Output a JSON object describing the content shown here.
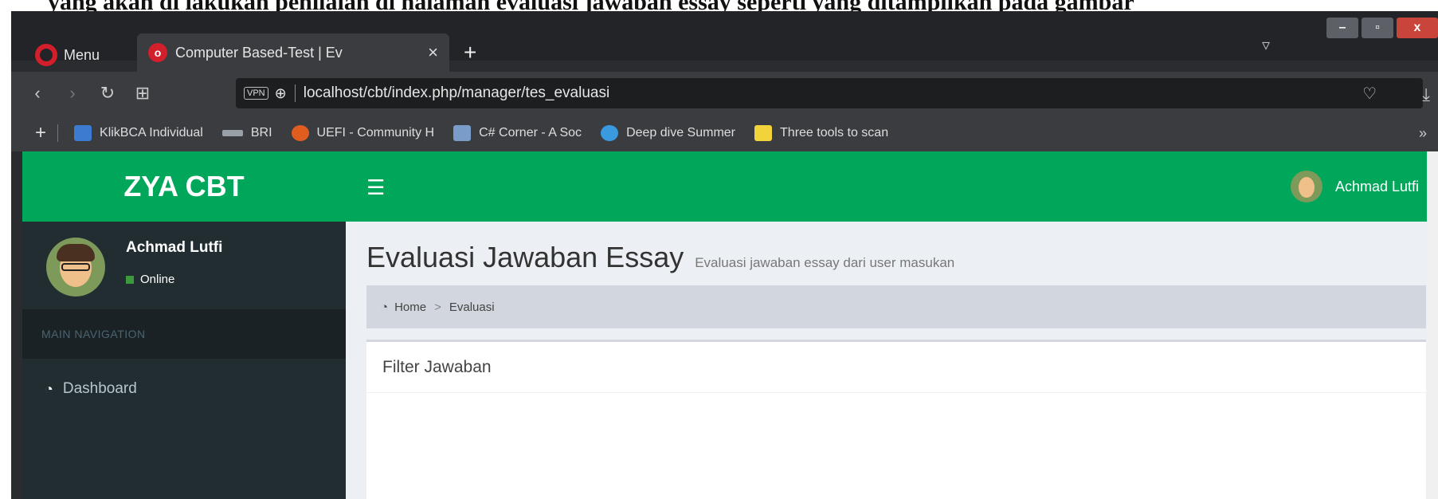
{
  "browser": {
    "menu_label": "Menu",
    "tab_title": "Computer Based-Test | Ev",
    "tab_close": "×",
    "new_tab": "+",
    "url": "localhost/cbt/index.php/manager/tes_evaluasi",
    "vpn_label": "VPN",
    "bookmarks": [
      {
        "label": "KlikBCA Individual",
        "icon": "klikbca-icon"
      },
      {
        "label": "BRI",
        "icon": "bri-icon"
      },
      {
        "label": "UEFI - Community H",
        "icon": "uefi-icon"
      },
      {
        "label": "C# Corner - A Soc",
        "icon": "csharp-icon"
      },
      {
        "label": "Deep dive Summer",
        "icon": "deep-dive-icon"
      },
      {
        "label": "Three tools to scan",
        "icon": "bulb-icon"
      }
    ],
    "bookmarks_more": "»"
  },
  "sidebar": {
    "logo": "ZYA CBT",
    "user_name": "Achmad Lutfi",
    "user_status": "Online",
    "section_header": "MAIN NAVIGATION",
    "items": [
      {
        "label": "Dashboard",
        "icon": "dashboard-icon"
      }
    ]
  },
  "topbar": {
    "menu_icon": "☰",
    "user_name": "Achmad Lutfi"
  },
  "content": {
    "title": "Evaluasi Jawaban Essay",
    "subtitle": "Evaluasi jawaban essay dari user masukan",
    "breadcrumb": [
      "Home",
      "Evaluasi"
    ],
    "box_title": "Filter Jawaban"
  },
  "colors": {
    "brand": "#00a65a",
    "sidebar": "#222d32",
    "content_bg": "#ecf0f5"
  }
}
